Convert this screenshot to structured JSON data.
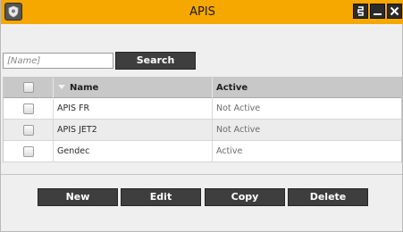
{
  "window": {
    "title": "APIS",
    "accent_color": "#f6a700"
  },
  "search": {
    "placeholder": "[Name]",
    "value": "",
    "button_label": "Search"
  },
  "grid": {
    "columns": [
      "Name",
      "Active"
    ],
    "rows": [
      {
        "name": "APIS FR",
        "active": "Not Active"
      },
      {
        "name": "APIS JET2",
        "active": "Not Active"
      },
      {
        "name": "Gendec",
        "active": "Active"
      }
    ]
  },
  "actions": {
    "new_label": "New",
    "edit_label": "Edit",
    "copy_label": "Copy",
    "delete_label": "Delete"
  }
}
